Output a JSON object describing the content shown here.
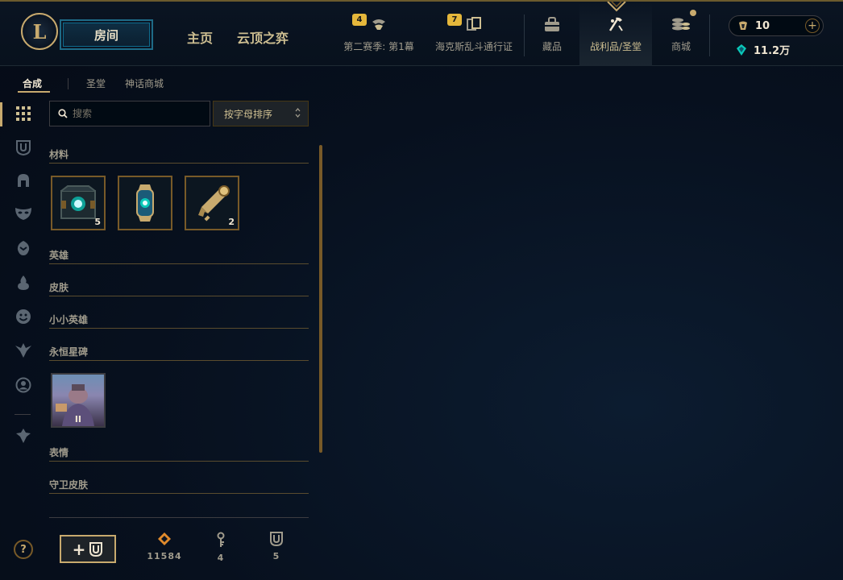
{
  "header": {
    "logo_letter": "L",
    "play_button": "房间",
    "main_nav": [
      "主页",
      "云顶之弈"
    ],
    "season": {
      "badge": "4",
      "label": "第二赛季: 第1幕"
    },
    "pass": {
      "badge": "7",
      "label": "海克斯乱斗通行证"
    },
    "collection_label": "藏品",
    "loot_label": "战利品/圣堂",
    "store_label": "商城",
    "rp_value": "10",
    "plus_symbol": "+",
    "be_value": "11.2万"
  },
  "subnav": {
    "tabs": [
      "合成",
      "圣堂",
      "神话商城"
    ],
    "active": "合成"
  },
  "search": {
    "placeholder": "搜索",
    "sort_label": "按字母排序"
  },
  "categories": {
    "materials": "材料",
    "champions": "英雄",
    "skins": "皮肤",
    "little_legends": "小小英雄",
    "eternals": "永恒星碑",
    "emotes": "表情",
    "ward_skins": "守卫皮肤"
  },
  "material_items": [
    {
      "name": "hextech-chest",
      "count": "5"
    },
    {
      "name": "mythic-capsule",
      "count": ""
    },
    {
      "name": "hextech-key",
      "count": "2"
    }
  ],
  "eternal_item": {
    "name": "eternal-tile",
    "roman": "II"
  },
  "bottom": {
    "help": "?",
    "add_plus": "+",
    "orange_essence": "11584",
    "keys": "4",
    "chests": "5"
  },
  "colors": {
    "gold": "#c8aa6e",
    "dark_gold": "#785a28",
    "blue_accent": "#0ac8b9",
    "badge": "#e5b73b"
  }
}
